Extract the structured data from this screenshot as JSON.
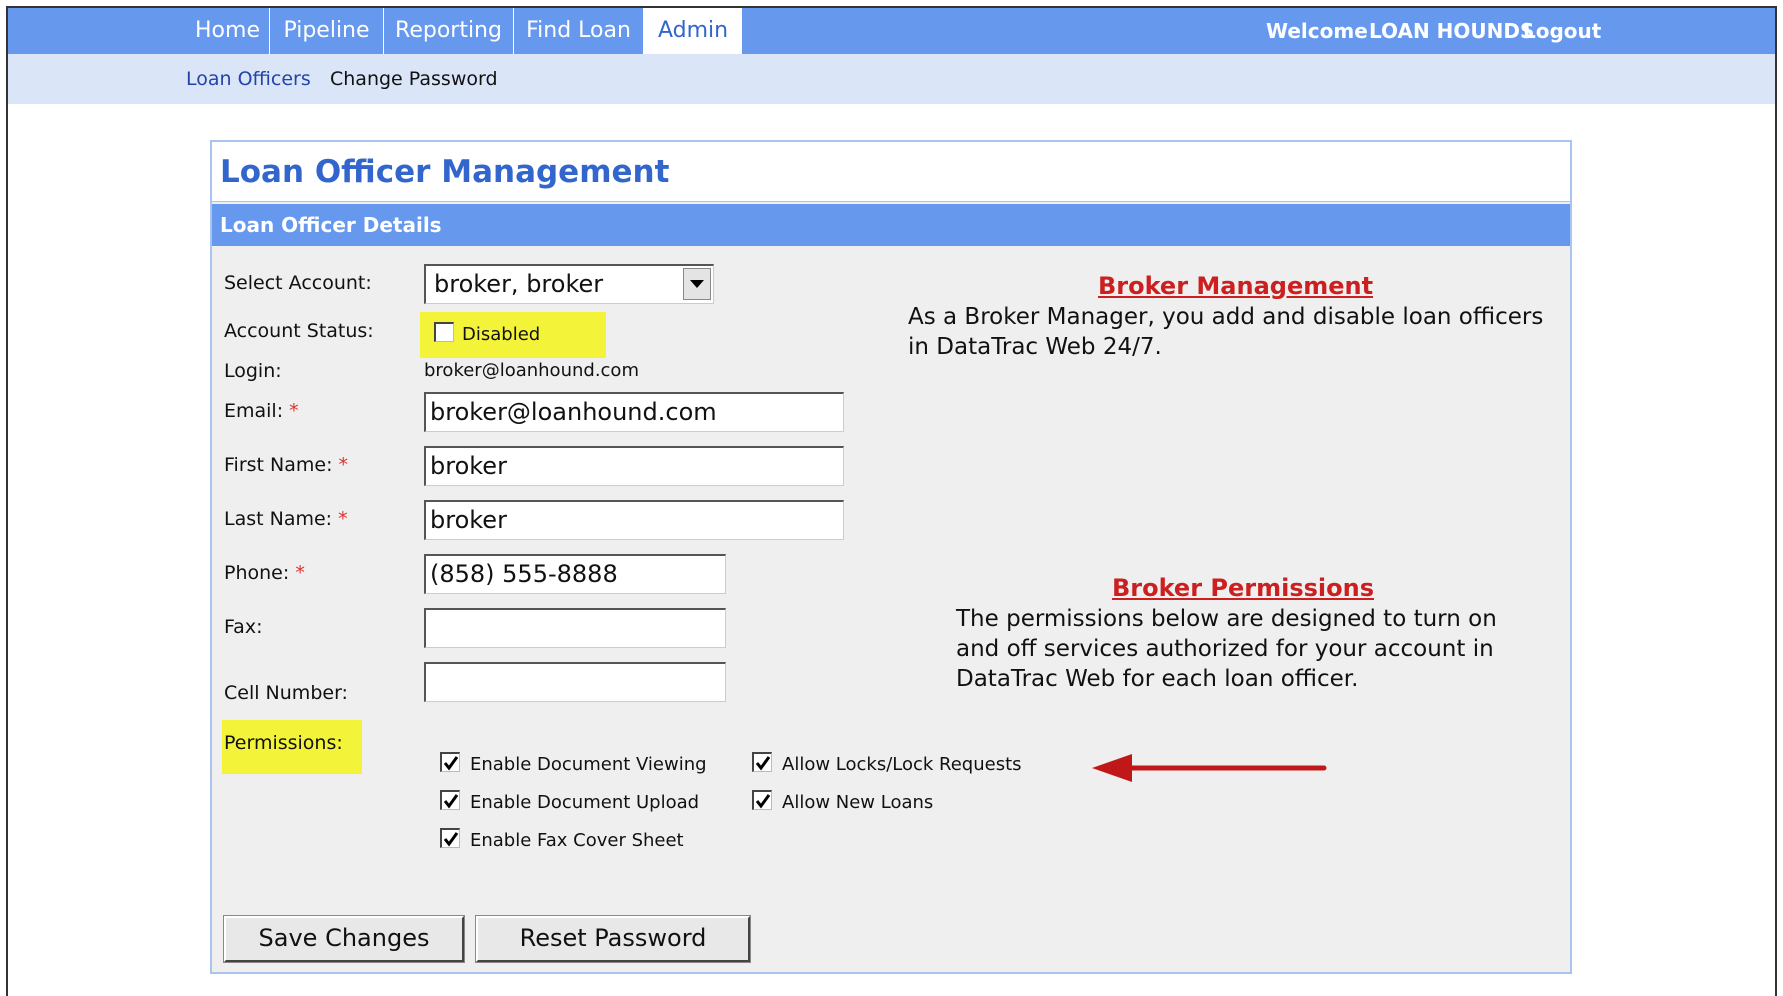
{
  "nav": {
    "tabs": [
      {
        "label": "Home"
      },
      {
        "label": "Pipeline"
      },
      {
        "label": "Reporting"
      },
      {
        "label": "Find Loan"
      },
      {
        "label": "Admin"
      }
    ],
    "welcome_label": "Welcome",
    "user_name": "LOAN HOUNDS",
    "logout_label": "Logout",
    "active_tab": "Admin"
  },
  "subnav": {
    "items": [
      {
        "label": "Loan Officers"
      },
      {
        "label": "Change Password"
      }
    ]
  },
  "panel": {
    "title": "Loan Officer Management",
    "section_title": "Loan Officer Details"
  },
  "form": {
    "select_account_label": "Select Account:",
    "select_account_value": "broker, broker",
    "account_status_label": "Account Status:",
    "disabled_label": "Disabled",
    "disabled_checked": false,
    "login_label": "Login:",
    "login_value": "broker@loanhound.com",
    "email_label": "Email:",
    "email_value": "broker@loanhound.com",
    "first_name_label": "First Name:",
    "first_name_value": "broker",
    "last_name_label": "Last Name:",
    "last_name_value": "broker",
    "phone_label": "Phone:",
    "phone_value": "(858) 555-8888",
    "fax_label": "Fax:",
    "fax_value": "",
    "cell_label": "Cell Number:",
    "cell_value": "",
    "required_mark": "*",
    "permissions_label": "Permissions:",
    "permissions": [
      {
        "label": "Enable Document Viewing",
        "checked": true
      },
      {
        "label": "Enable Document Upload",
        "checked": true
      },
      {
        "label": "Enable Fax Cover Sheet",
        "checked": true
      },
      {
        "label": "Allow Locks/Lock Requests",
        "checked": true
      },
      {
        "label": "Allow New Loans",
        "checked": true
      }
    ]
  },
  "info": {
    "broker_management_heading": "Broker Management",
    "broker_management_text_1": "As a Broker Manager, you add and disable loan officers",
    "broker_management_text_2": "in DataTrac Web 24/7.",
    "broker_permissions_heading": "Broker Permissions",
    "broker_permissions_text_1": "The permissions below are designed to turn on",
    "broker_permissions_text_2": "and off services authorized for your account in",
    "broker_permissions_text_3": "DataTrac Web for each loan officer."
  },
  "buttons": {
    "save_label": "Save Changes",
    "reset_label": "Reset Password"
  },
  "colors": {
    "nav_blue": "#6699ee",
    "highlight_yellow": "#f3f43a",
    "heading_red": "#cc1f1f",
    "arrow_red": "#c01818"
  }
}
